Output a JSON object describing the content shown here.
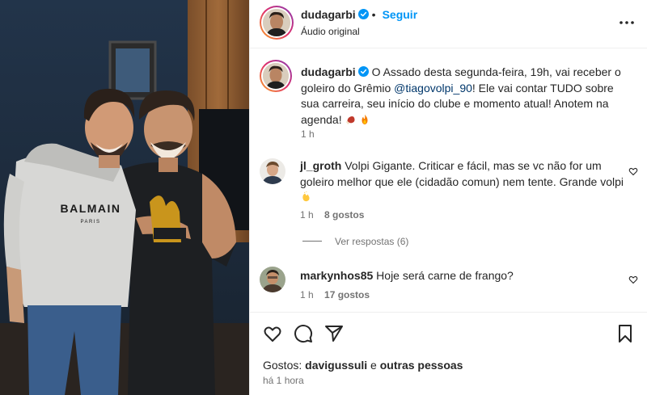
{
  "post": {
    "username": "dudagarbi",
    "follow_label": "Seguir",
    "separator": "•",
    "audio_label": "Áudio original",
    "verified_icon": "verified-badge-icon",
    "more_icon": "more-options-icon"
  },
  "caption": {
    "username": "dudagarbi",
    "text_part1": "O Assado desta segunda-feira, 19h, vai receber o goleiro do Grêmio ",
    "mention": "@tiagovolpi_90",
    "text_part2": "! Ele vai contar TUDO sobre sua carreira, seu início do clube e momento atual! Anotem na agenda! ",
    "emojis": [
      "meat-on-bone-emoji",
      "fire-emoji"
    ],
    "time": "1 h"
  },
  "comments": [
    {
      "username": "jl_groth",
      "text": "Volpi Gigante. Criticar e fácil, mas se vc não for um goleiro melhor que ele (cidadão comun) nem tente. Grande volpi",
      "emoji": "clapping-hands-emoji",
      "time": "1 h",
      "likes": "8 gostos",
      "replies_label": "Ver respostas (6)"
    },
    {
      "username": "markynhos85",
      "text": "Hoje será carne de frango?",
      "time": "1 h",
      "likes": "17 gostos"
    }
  ],
  "actions": {
    "icons": [
      "heart-icon",
      "comment-icon",
      "share-icon",
      "bookmark-icon"
    ],
    "likes_prefix": "Gostos: ",
    "likes_user": "davigussuli",
    "likes_conj": " e ",
    "likes_others": "outras pessoas",
    "timestamp": "há 1 hora"
  },
  "colors": {
    "link": "#0095f6",
    "mention": "#00376b",
    "muted": "#737373",
    "text": "#262626",
    "divider": "#efefef"
  },
  "photo": {
    "shirt_brand": "BALMAIN",
    "shirt_sub": "PARIS"
  }
}
